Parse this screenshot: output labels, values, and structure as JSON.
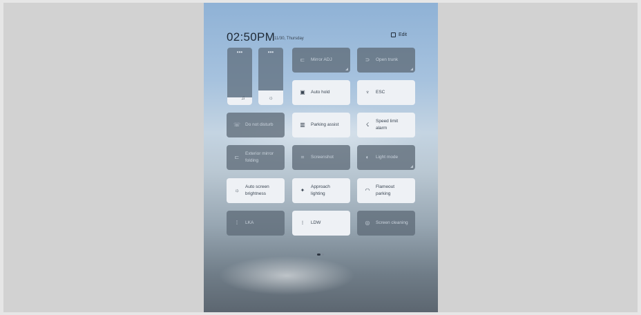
{
  "status": {
    "time": "02:50PM",
    "date": "11/30, Thursday",
    "edit_label": "Edit"
  },
  "sliders": [
    {
      "name": "media-volume",
      "icon": "music-note-icon",
      "glyph": "♫",
      "level": 0.13
    },
    {
      "name": "brightness",
      "icon": "sun-icon",
      "glyph": "☼",
      "level": 0.25
    }
  ],
  "tiles": {
    "mirror_adj": {
      "label": "Mirror ADJ",
      "state": "off",
      "icon": "mirror-icon",
      "glyph": "⊏"
    },
    "open_trunk": {
      "label": "Open trunk",
      "state": "off",
      "icon": "trunk-icon",
      "glyph": "⊃"
    },
    "auto_hold": {
      "label": "Auto hold",
      "state": "on",
      "icon": "auto-hold-icon",
      "glyph": "▣"
    },
    "esc": {
      "label": "ESC",
      "state": "on",
      "icon": "esc-icon",
      "glyph": "♆"
    },
    "do_not_disturb": {
      "label": "Do not disturb",
      "state": "off",
      "icon": "do-not-disturb-icon",
      "glyph": "☏"
    },
    "parking_assist": {
      "label": "Parking assist",
      "state": "on",
      "icon": "parking-assist-icon",
      "glyph": "▥"
    },
    "speed_limit_alarm": {
      "label": "Speed limit\nalarm",
      "state": "on",
      "icon": "speed-limit-icon",
      "glyph": "☇"
    },
    "exterior_mirror_folding": {
      "label": "Exterior mirror\nfolding",
      "state": "off",
      "icon": "mirror-fold-icon",
      "glyph": "⊏"
    },
    "screenshot": {
      "label": "Screenshot",
      "state": "off",
      "icon": "screenshot-icon",
      "glyph": "⌗"
    },
    "light_mode": {
      "label": "Light mode",
      "state": "off",
      "icon": "light-mode-icon",
      "glyph": "◐"
    },
    "auto_screen_brightness": {
      "label": "Auto screen\nbrightness",
      "state": "on",
      "icon": "auto-brightness-icon",
      "glyph": "☼"
    },
    "approach_lighting": {
      "label": "Approach\nlighting",
      "state": "on",
      "icon": "approach-lighting-icon",
      "glyph": "✦"
    },
    "flameout_parking": {
      "label": "Flameout\nparking",
      "state": "on",
      "icon": "flameout-parking-icon",
      "glyph": "◠"
    },
    "lka": {
      "label": "LKA",
      "state": "off",
      "icon": "lane-keep-icon",
      "glyph": "⁞"
    },
    "ldw": {
      "label": "LDW",
      "state": "on",
      "icon": "lane-departure-icon",
      "glyph": "⁝"
    },
    "screen_cleaning": {
      "label": "Screen cleaning",
      "state": "off",
      "icon": "screen-cleaning-icon",
      "glyph": "◎"
    }
  },
  "pager": {
    "pages": 2,
    "current": 1
  }
}
